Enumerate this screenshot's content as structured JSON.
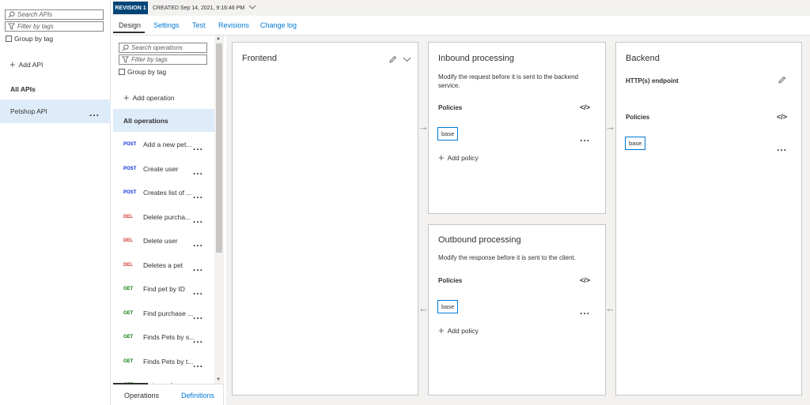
{
  "apis_panel": {
    "search_placeholder": "Search APIs",
    "filter_placeholder": "Filter by tags",
    "group_by_tag": "Group by tag",
    "add_api": "Add API",
    "all_apis": "All APIs",
    "selected_api": "Petshop API"
  },
  "top_bar": {
    "revision": "REVISION 1",
    "created": "CREATED Sep 14, 2021, 9:16:46 PM"
  },
  "tabs": [
    "Design",
    "Settings",
    "Test",
    "Revisions",
    "Change log"
  ],
  "operations_panel": {
    "search_placeholder": "Search operations",
    "filter_placeholder": "Filter by tags",
    "group_by_tag": "Group by tag",
    "add_operation": "Add operation",
    "all_operations": "All operations",
    "operations": [
      {
        "verb": "POST",
        "name": "Add a new pet..."
      },
      {
        "verb": "POST",
        "name": "Create user"
      },
      {
        "verb": "POST",
        "name": "Creates list of ..."
      },
      {
        "verb": "DEL",
        "name": "Delete purcha..."
      },
      {
        "verb": "DEL",
        "name": "Delete user"
      },
      {
        "verb": "DEL",
        "name": "Deletes a pet"
      },
      {
        "verb": "GET",
        "name": "Find pet by ID"
      },
      {
        "verb": "GET",
        "name": "Find purchase ..."
      },
      {
        "verb": "GET",
        "name": "Finds Pets by s..."
      },
      {
        "verb": "GET",
        "name": "Finds Pets by t..."
      },
      {
        "verb": "GET",
        "name": "Get user by us..."
      }
    ],
    "bottom_tabs": [
      "Operations",
      "Definitions"
    ]
  },
  "verb_colors": {
    "POST": "#0b2fd6",
    "DEL": "#d13438",
    "GET": "#107c10"
  },
  "frontend": {
    "title": "Frontend"
  },
  "inbound": {
    "title": "Inbound processing",
    "description": "Modify the request before it is sent to the backend service.",
    "policies": "Policies",
    "base": "base",
    "add_policy": "Add policy"
  },
  "outbound": {
    "title": "Outbound processing",
    "description": "Modify the response before it is sent to the client.",
    "policies": "Policies",
    "base": "base",
    "add_policy": "Add policy"
  },
  "backend": {
    "title": "Backend",
    "endpoint": "HTTP(s) endpoint",
    "policies": "Policies",
    "base": "base"
  },
  "icons": {
    "code": "</>",
    "dots": "...",
    "plus": "+"
  }
}
